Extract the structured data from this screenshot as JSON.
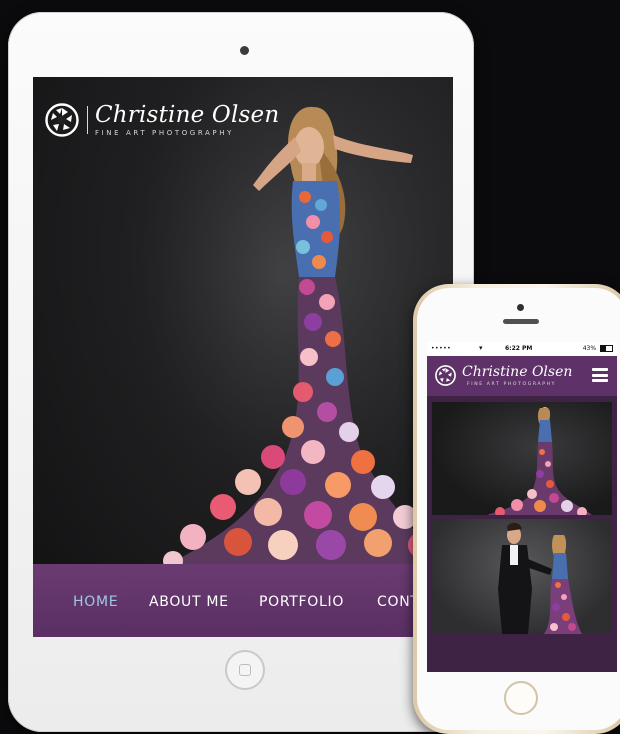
{
  "brand": {
    "name": "Christine Olsen",
    "tagline": "FINE ART PHOTOGRAPHY"
  },
  "tablet_nav": {
    "items": [
      {
        "label": "HOME",
        "active": true
      },
      {
        "label": "ABOUT ME",
        "active": false
      },
      {
        "label": "PORTFOLIO",
        "active": false
      },
      {
        "label": "CONT",
        "active": false
      }
    ]
  },
  "phone_status": {
    "carrier": "•••••",
    "wifi": "wifi-icon",
    "time": "6:22 PM",
    "battery": "43%"
  },
  "icons": {
    "logo": "aperture-icon",
    "menu": "hamburger-menu-icon"
  },
  "colors": {
    "nav_purple": "#5e3268",
    "nav_active": "#9ec9e6",
    "device_white": "#fbfbfb",
    "device_gold": "#e8d9bb"
  }
}
